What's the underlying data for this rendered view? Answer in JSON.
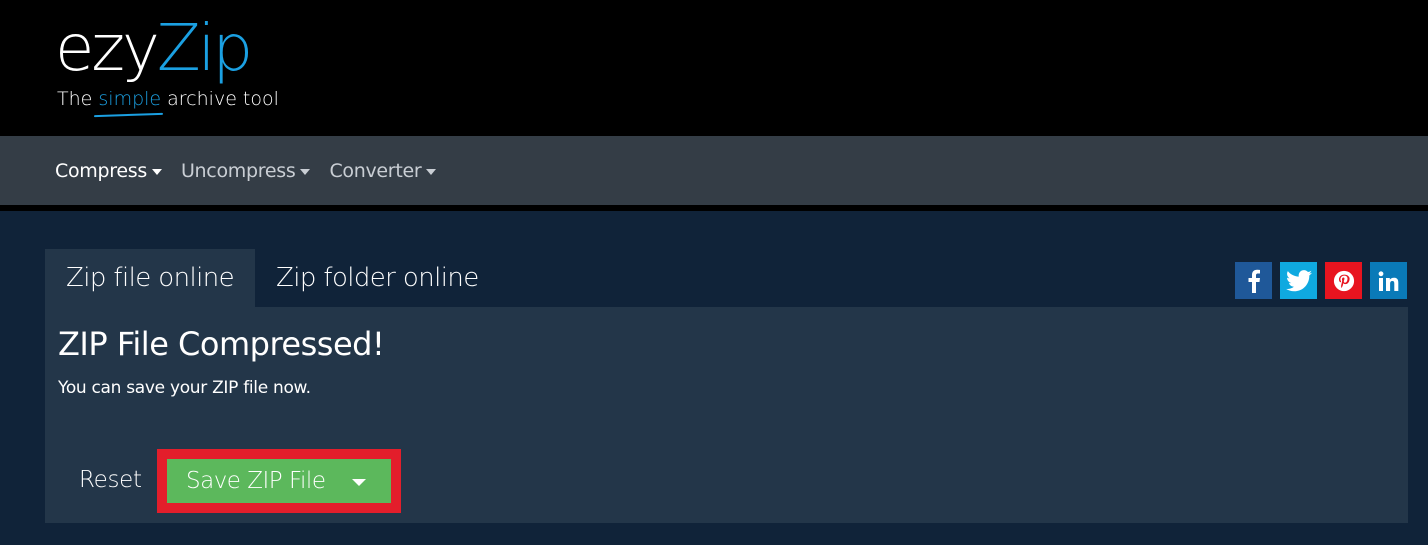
{
  "logo": {
    "part1": "ezy",
    "part2": "Zip",
    "tagline_before": "The ",
    "tagline_highlight": "simple",
    "tagline_after": " archive tool"
  },
  "nav": {
    "items": [
      {
        "label": "Compress",
        "active": true
      },
      {
        "label": "Uncompress",
        "active": false
      },
      {
        "label": "Converter",
        "active": false
      }
    ]
  },
  "tabs": [
    {
      "label": "Zip file online",
      "active": true
    },
    {
      "label": "Zip folder online",
      "active": false
    }
  ],
  "social": [
    {
      "name": "facebook-icon",
      "glyph": "f",
      "color": "#1f5899"
    },
    {
      "name": "twitter-icon",
      "glyph": "🐦",
      "color": "#0fa9e0"
    },
    {
      "name": "pinterest-icon",
      "glyph": "P",
      "color": "#e8141f"
    },
    {
      "name": "linkedin-icon",
      "glyph": "in",
      "color": "#0a7ab8"
    }
  ],
  "panel": {
    "title": "ZIP File Compressed!",
    "message": "You can save your ZIP file now.",
    "reset_label": "Reset",
    "save_label": "Save ZIP File"
  },
  "colors": {
    "accent_blue": "#1ba0e2",
    "save_green": "#5cb85c",
    "highlight_red": "#e31e2b"
  }
}
